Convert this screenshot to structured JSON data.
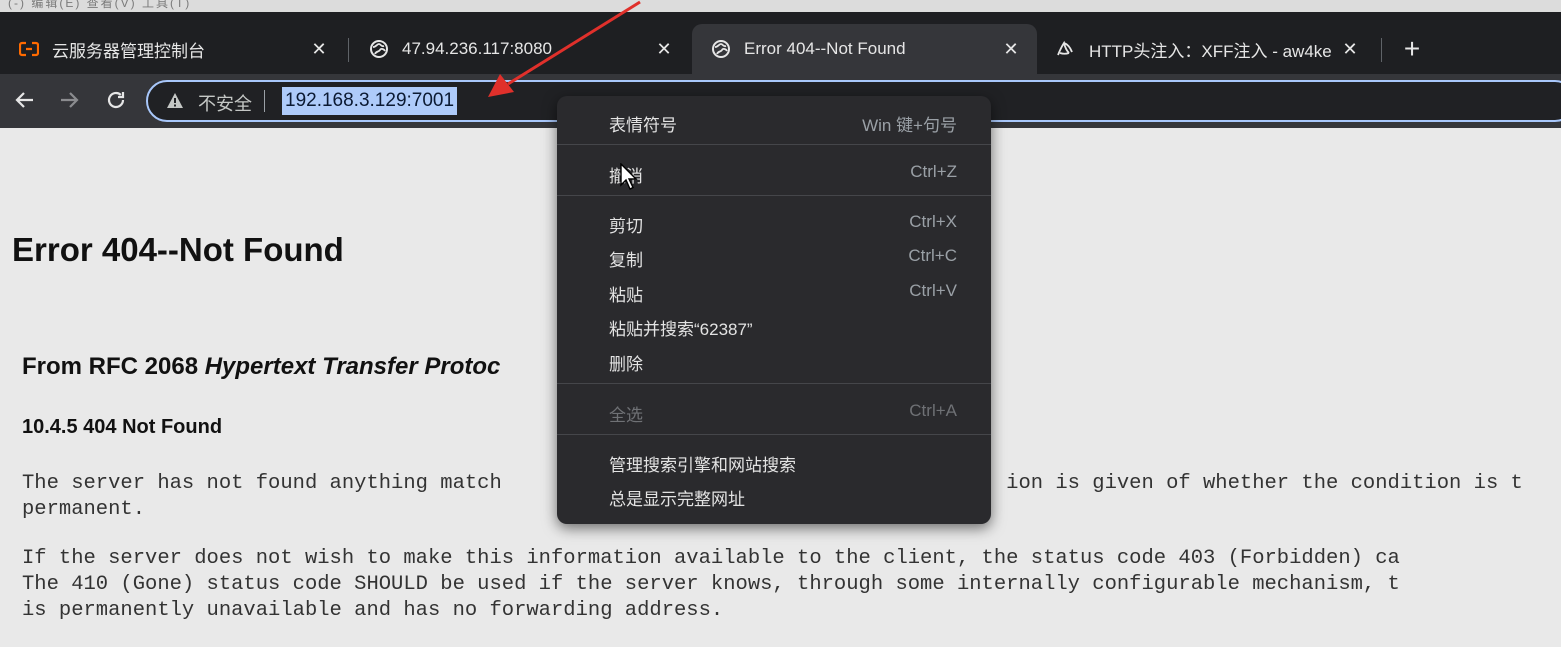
{
  "top_menu_fragment": "(-) 编辑(E) 查看(V) 工具(T)",
  "tabs": [
    {
      "title": "云服务器管理控制台",
      "icon": "aliyun-console-icon",
      "close": "✕"
    },
    {
      "title": "47.94.236.117:8080",
      "icon": "globe-icon",
      "close": "✕"
    },
    {
      "title": "Error 404--Not Found",
      "icon": "globe-icon",
      "close": "✕"
    },
    {
      "title": "HTTP头注入：XFF注入 - aw4ke",
      "icon": "custom-site-icon",
      "close": "✕"
    }
  ],
  "new_tab": "+",
  "address": {
    "security_label": "不安全",
    "url": "192.168.3.129:7001"
  },
  "page": {
    "title": "Error 404--Not Found",
    "rfc_heading_prefix": "From RFC 2068 ",
    "rfc_heading_italic": "Hypertext Transfer Protoc",
    "section_heading": "10.4.5 404 Not Found",
    "para1": "The server has not found anything match                                         ion is given of whether the condition is t\npermanent.",
    "para2": "If the server does not wish to make this information available to the client, the status code 403 (Forbidden) ca\nThe 410 (Gone) status code SHOULD be used if the server knows, through some internally configurable mechanism, t\nis permanently unavailable and has no forwarding address."
  },
  "context_menu": {
    "items": [
      {
        "label": "表情符号",
        "shortcut": "Win 键+句号",
        "disabled": false
      },
      {
        "label": "撤消",
        "shortcut": "Ctrl+Z",
        "disabled": false
      },
      {
        "label": "剪切",
        "shortcut": "Ctrl+X",
        "disabled": false
      },
      {
        "label": "复制",
        "shortcut": "Ctrl+C",
        "disabled": false
      },
      {
        "label": "粘贴",
        "shortcut": "Ctrl+V",
        "disabled": false
      },
      {
        "label": "粘贴并搜索“62387”",
        "shortcut": "",
        "disabled": false
      },
      {
        "label": "删除",
        "shortcut": "",
        "disabled": false
      },
      {
        "label": "全选",
        "shortcut": "Ctrl+A",
        "disabled": true
      },
      {
        "label": "管理搜索引擎和网站搜索",
        "shortcut": "",
        "disabled": false
      },
      {
        "label": "总是显示完整网址",
        "shortcut": "",
        "disabled": false
      }
    ]
  },
  "colors": {
    "tabstrip": "#1e1f22",
    "toolbar": "#35363a",
    "omnibox_focus": "#a8c7fa",
    "url_selection": "#aecbfa",
    "menu_bg": "#2a2a2d",
    "annotation_arrow": "#e0302b",
    "page_bg": "#e9e9e9"
  }
}
